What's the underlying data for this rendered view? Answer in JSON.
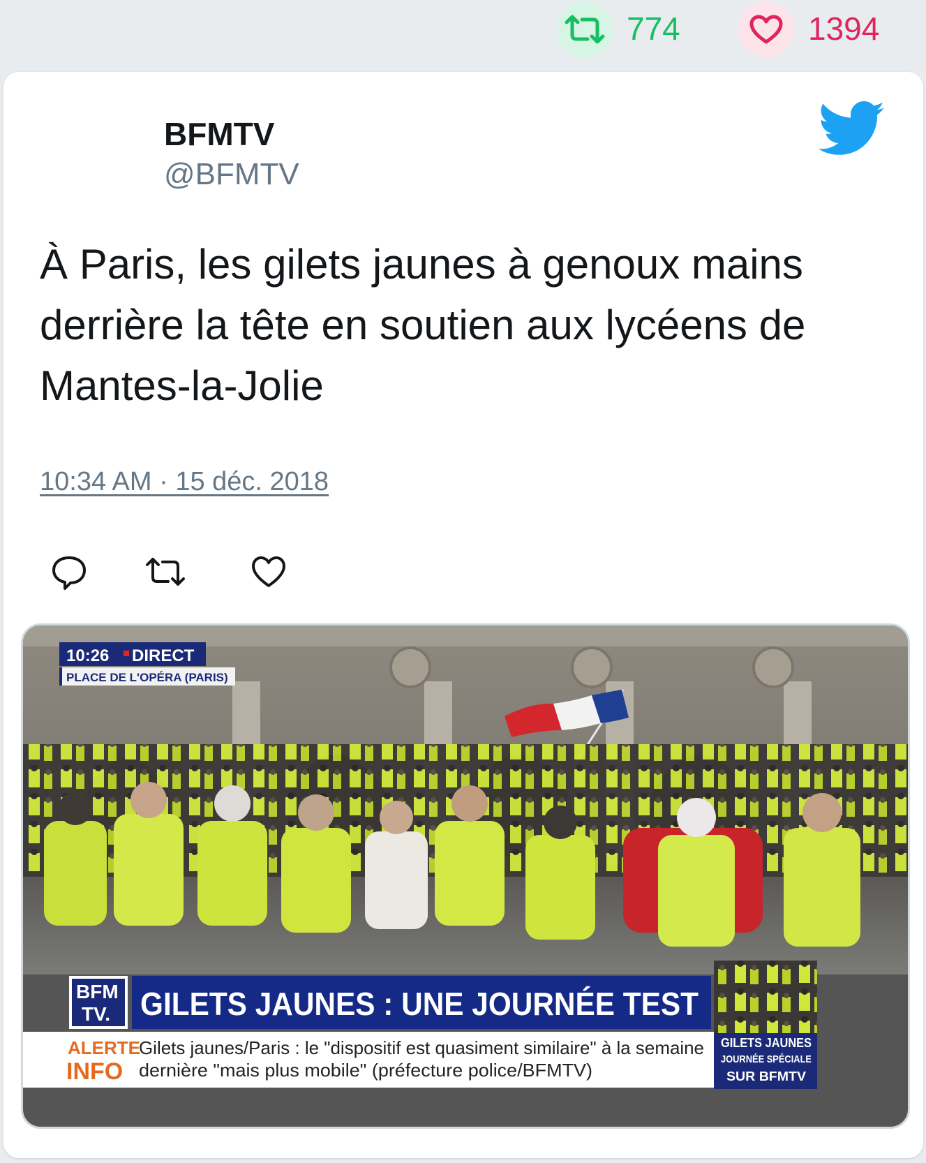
{
  "stats": {
    "retweets": "774",
    "likes": "1394"
  },
  "tweet": {
    "author_name": "BFMTV",
    "author_handle": "@BFMTV",
    "text": "À Paris, les gilets jaunes à genoux mains derrière la tête en soutien aux lycéens de Mantes-la-Jolie",
    "timestamp": "10:34 AM · 15 déc. 2018"
  },
  "media": {
    "live_time": "10:26",
    "live_label": "DIRECT",
    "location": "PLACE DE L'OPÉRA (PARIS)",
    "logo_line1": "BFM",
    "logo_line2": "TV.",
    "headline": "GILETS JAUNES : UNE JOURNÉE TEST",
    "alert_line1": "ALERTE",
    "alert_line2": "INFO",
    "ticker_line1": "Gilets jaunes/Paris : le \"dispositif est quasiment similaire\" à la semaine",
    "ticker_line2": "dernière \"mais plus mobile\" (préfecture police/BFMTV)",
    "promo_line1": "GILETS JAUNES",
    "promo_line2": "JOURNÉE SPÉCIALE",
    "promo_line3": "SUR BFMTV"
  },
  "colors": {
    "retweet": "#17bf63",
    "like": "#e0245e",
    "twitter_blue": "#1da1f2",
    "secondary_text": "#657786"
  },
  "icons": [
    "retweet-icon",
    "heart-icon",
    "twitter-bird-icon",
    "reply-icon"
  ]
}
